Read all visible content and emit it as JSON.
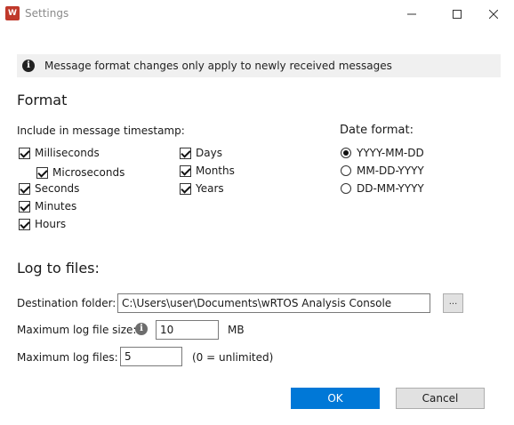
{
  "window": {
    "title": "Settings",
    "app_icon_text": "W",
    "minimize_icon": "minimize-icon",
    "maximize_icon": "maximize-icon",
    "close_icon": "close-icon"
  },
  "info_banner": {
    "icon": "info-icon",
    "text": "Message format changes only apply to newly received messages"
  },
  "format": {
    "title": "Format",
    "timestamp_label": "Include in message timestamp:",
    "options": [
      {
        "label": "Milliseconds",
        "checked": true
      },
      {
        "label": "Microseconds",
        "checked": true
      },
      {
        "label": "Seconds",
        "checked": true
      },
      {
        "label": "Minutes",
        "checked": true
      },
      {
        "label": "Hours",
        "checked": true
      },
      {
        "label": "Days",
        "checked": true
      },
      {
        "label": "Months",
        "checked": true
      },
      {
        "label": "Years",
        "checked": true
      }
    ],
    "date_format_label": "Date format:",
    "date_formats": [
      {
        "label": "YYYY-MM-DD",
        "selected": true
      },
      {
        "label": "MM-DD-YYYY",
        "selected": false
      },
      {
        "label": "DD-MM-YYYY",
        "selected": false
      }
    ]
  },
  "log": {
    "title": "Log to files:",
    "destination_label": "Destination folder:",
    "destination_value": "C:\\Users\\user\\Documents\\wRTOS Analysis Console",
    "browse_label": "...",
    "max_size_label": "Maximum log file size:",
    "max_size_value": "10",
    "max_size_unit": "MB",
    "max_files_label": "Maximum log files:",
    "max_files_value": "5",
    "max_files_hint": "(0 = unlimited)"
  },
  "buttons": {
    "ok": "OK",
    "cancel": "Cancel"
  },
  "colors": {
    "accent": "#0078d7",
    "banner_bg": "#f0f0f0"
  }
}
